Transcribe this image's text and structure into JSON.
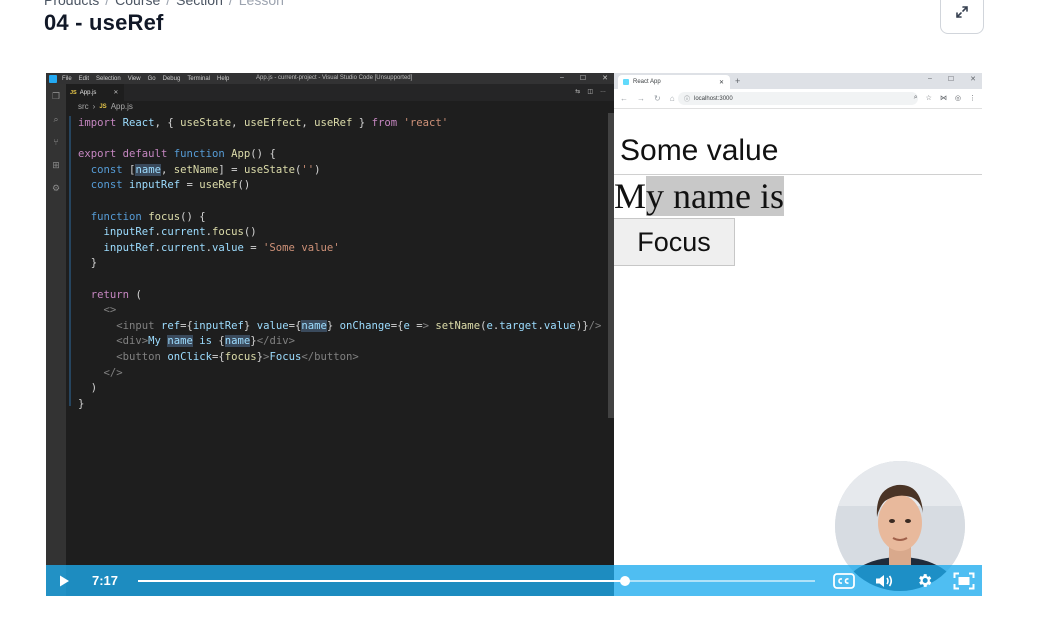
{
  "breadcrumb": {
    "items": [
      "Products",
      "Course",
      "Section",
      "Lesson"
    ],
    "separator": "/"
  },
  "page": {
    "title": "04 - useRef"
  },
  "vscode": {
    "menu": [
      "File",
      "Edit",
      "Selection",
      "View",
      "Go",
      "Debug",
      "Terminal",
      "Help"
    ],
    "window_title": "App.js - current-project - Visual Studio Code [Unsupported]",
    "tab_label": "App.js",
    "tab_badge": "JS",
    "breadcrumb_folder": "src",
    "breadcrumb_file": "App.js",
    "code_lines": [
      "import React, { useState, useEffect, useRef } from 'react'",
      "",
      "export default function App() {",
      "  const [name, setName] = useState('')",
      "  const inputRef = useRef()",
      "",
      "  function focus() {",
      "    inputRef.current.focus()",
      "    inputRef.current.value = 'Some value'",
      "  }",
      "",
      "  return (",
      "    <>",
      "      <input ref={inputRef} value={name} onChange={e => setName(e.target.value)}/>",
      "      <div>My name is {name}</div>",
      "      <button onClick={focus}>Focus</button>",
      "    </>",
      "  )",
      "}"
    ]
  },
  "browser": {
    "tab_title": "React App",
    "url": "localhost:3000",
    "input_value": "Some value",
    "div_text_plain": "M",
    "div_text_selected": "y name is",
    "button_label": "Focus"
  },
  "player": {
    "current_time": "7:17",
    "progress_fraction": 0.72,
    "accent": "#1dacee"
  },
  "icons": {
    "expand": "expand-arrows-icon",
    "play": "play-icon",
    "cc": "closed-captions-icon",
    "volume": "volume-icon",
    "settings": "gear-icon",
    "fullscreen": "fullscreen-icon"
  }
}
